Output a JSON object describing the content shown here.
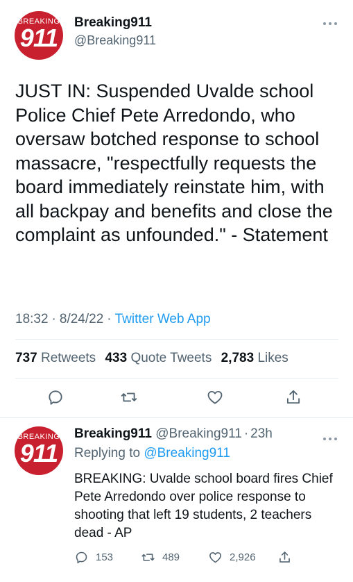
{
  "tweet": {
    "avatar_top": "BREAKING",
    "avatar_num": "911",
    "display_name": "Breaking911",
    "handle": "@Breaking911",
    "more_icon": "ellipsis-icon",
    "text": "JUST IN: Suspended Uvalde school Police Chief Pete Arredondo, who oversaw botched response to school massacre, \"respectfully requests the board immediately reinstate him, with all backpay and benefits and close the complaint as unfounded.\" - Statement",
    "time": "18:32",
    "date": "8/24/22",
    "client": "Twitter Web App",
    "sep": "·",
    "retweets_count": "737",
    "retweets_label": "Retweets",
    "quotes_count": "433",
    "quotes_label": "Quote Tweets",
    "likes_count": "2,783",
    "likes_label": "Likes"
  },
  "reply": {
    "avatar_top": "BREAKING",
    "avatar_num": "911",
    "display_name": "Breaking911",
    "handle": "@Breaking911",
    "sep": "·",
    "age": "23h",
    "replying_to": "Replying to",
    "mention": "@Breaking911",
    "text": "BREAKING: Uvalde school board fires Chief Pete Arredondo over police response to shooting that left 19 students, 2 teachers dead - AP",
    "reply_count": "153",
    "retweet_count": "489",
    "like_count": "2,926"
  },
  "colors": {
    "accent": "#1d9bf0",
    "text": "#0f1419",
    "muted": "#536471",
    "avatar": "#c8202e"
  }
}
